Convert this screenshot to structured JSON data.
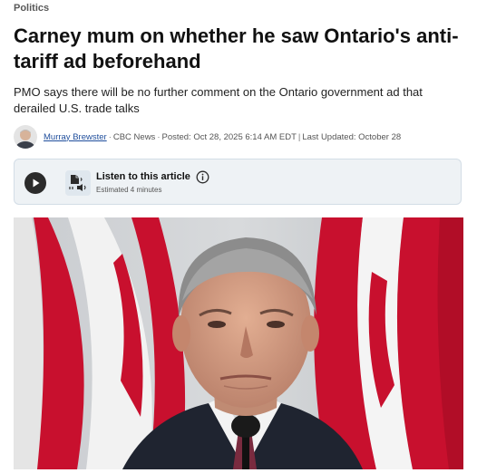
{
  "section": "Politics",
  "headline": "Carney mum on whether he saw Ontario's anti-tariff ad beforehand",
  "deck": "PMO says there will be no further comment on the Ontario government ad that derailed U.S. trade talks",
  "byline": {
    "author": "Murray Brewster",
    "source": "CBC News",
    "posted": "Posted: Oct 28, 2025 6:14 AM EDT",
    "updated": "Last Updated: October 28"
  },
  "listen": {
    "title": "Listen to this article",
    "estimate": "Estimated 4 minutes"
  },
  "icons": {
    "play": "play-icon",
    "document_audio": "document-audio-icon",
    "info": "info-icon"
  },
  "colors": {
    "link": "#1f4e9c",
    "listen_bg": "#eef2f5",
    "flag_red": "#c8102e"
  }
}
